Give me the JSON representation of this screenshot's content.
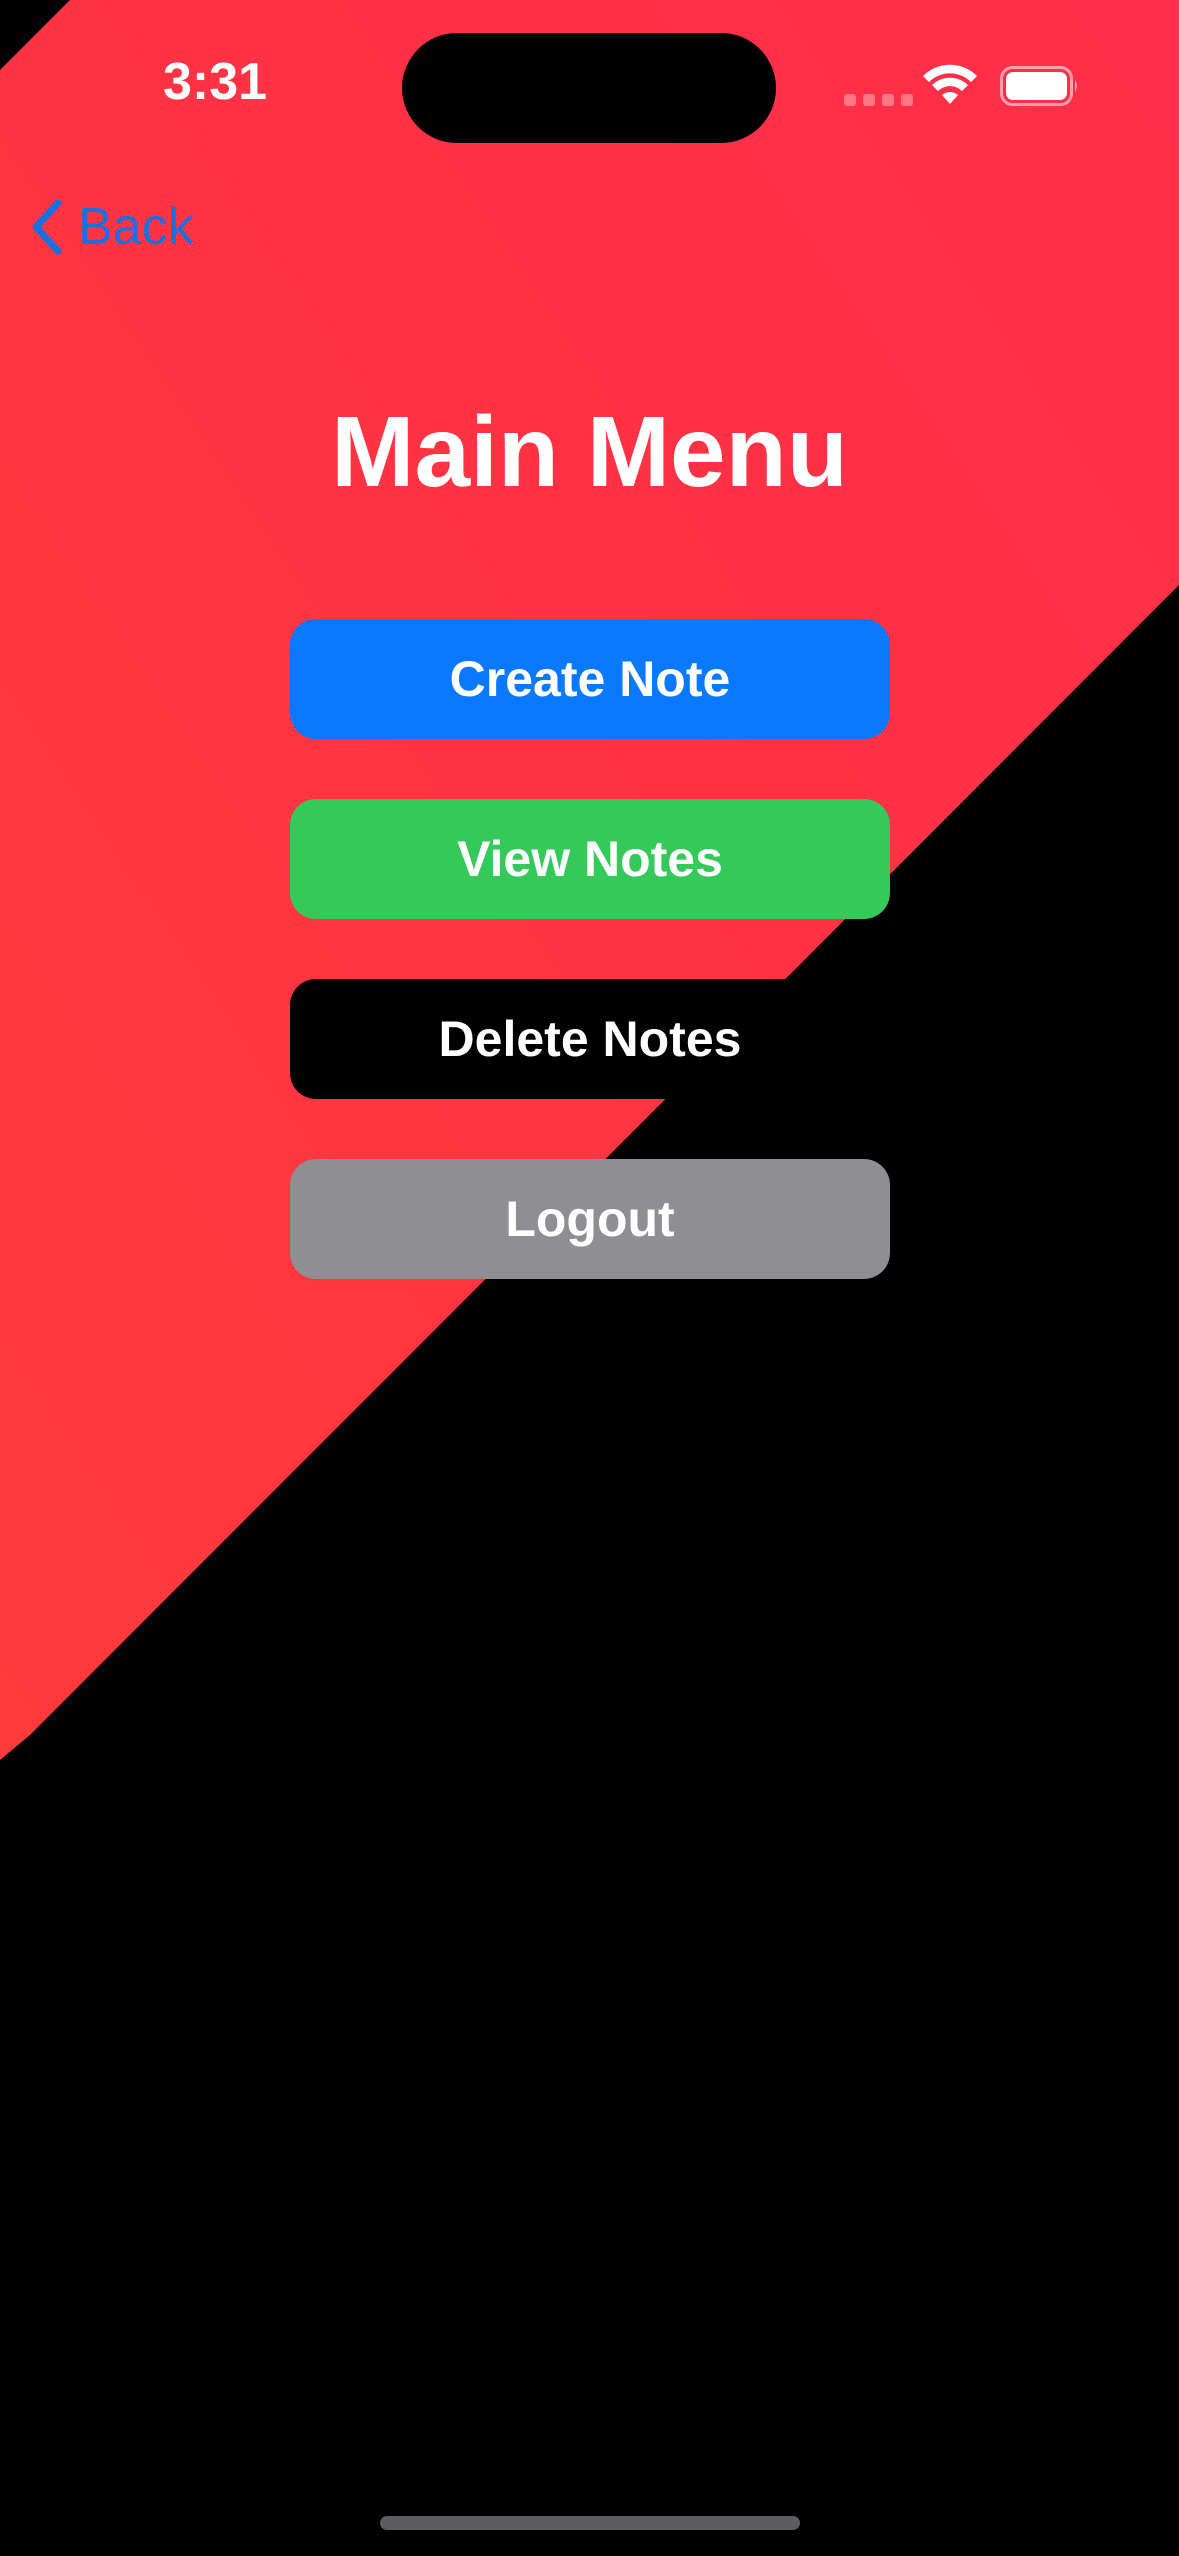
{
  "status_bar": {
    "time": "3:31",
    "icons": [
      "cellular-signal-icon",
      "wifi-icon",
      "battery-icon"
    ]
  },
  "nav": {
    "back_label": "Back",
    "back_icon": "chevron-left-icon"
  },
  "page": {
    "title": "Main Menu"
  },
  "menu": {
    "create_label": "Create Note",
    "view_label": "View Notes",
    "delete_label": "Delete Notes",
    "logout_label": "Logout"
  },
  "colors": {
    "background": "#000000",
    "gradient_start": "#ff3b3b",
    "gradient_end": "#ff2d4a",
    "back_link": "#1b6fe0",
    "create_button": "#0a78ff",
    "view_button": "#35c95a",
    "delete_button": "#000000",
    "logout_button": "#8e8e93"
  }
}
